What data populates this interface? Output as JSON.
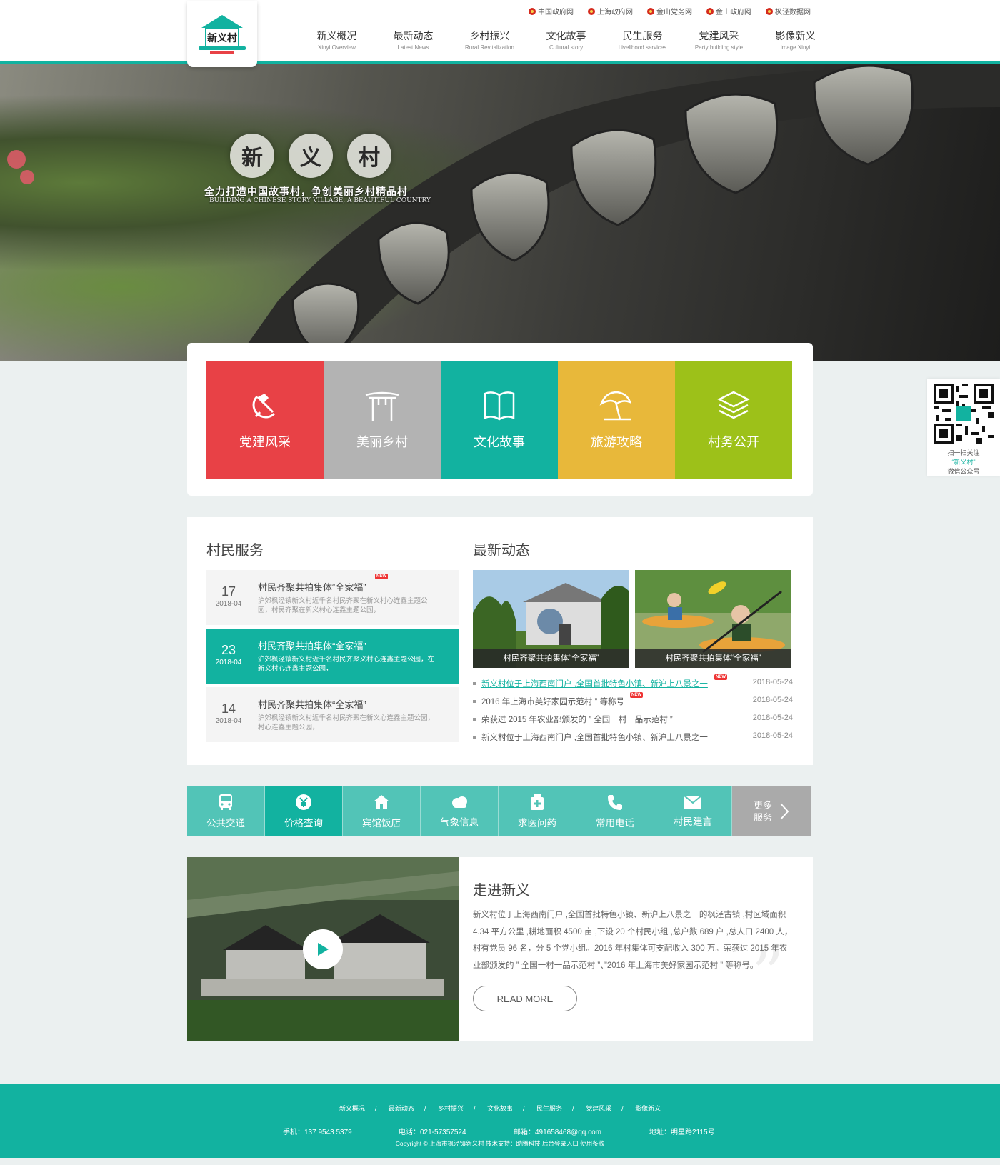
{
  "header": {
    "logo_text": "新义村",
    "top_links": [
      "中国政府网",
      "上海政府网",
      "金山党务网",
      "金山政府网",
      "枫泾数据网"
    ],
    "nav": [
      {
        "cn": "新义概况",
        "en": "Xinyi Overview"
      },
      {
        "cn": "最新动态",
        "en": "Latest News"
      },
      {
        "cn": "乡村振兴",
        "en": "Rural Revitalization"
      },
      {
        "cn": "文化故事",
        "en": "Cultural story"
      },
      {
        "cn": "民生服务",
        "en": "Livelihood services"
      },
      {
        "cn": "党建风采",
        "en": "Party building style"
      },
      {
        "cn": "影像新义",
        "en": "image Xinyi"
      }
    ]
  },
  "banner": {
    "chars": [
      "新",
      "义",
      "村"
    ],
    "slogan": "全力打造中国故事村，争创美丽乡村精品村",
    "slogan_en": "BUILDING A CHINESE STORY VILLAGE, A BEAUTIFUL COUNTRY"
  },
  "tiles": [
    {
      "label": "党建风采",
      "icon": "hammer-sickle-icon",
      "color": "#e84146"
    },
    {
      "label": "美丽乡村",
      "icon": "archway-icon",
      "color": "#b3b3b3"
    },
    {
      "label": "文化故事",
      "icon": "book-icon",
      "color": "#12b2a0"
    },
    {
      "label": "旅游攻略",
      "icon": "beach-umbrella-icon",
      "color": "#e8b83a"
    },
    {
      "label": "村务公开",
      "icon": "layers-icon",
      "color": "#9dc119"
    }
  ],
  "qr": {
    "line1": "扫一扫关注",
    "line2": "“新义村”",
    "line3": "微信公众号"
  },
  "services": {
    "title": "村民服务",
    "items": [
      {
        "day": "17",
        "month": "2018-04",
        "title": "村民齐聚共拍集体“全家福”",
        "desc": "沪郊枫泾镇新义村近千名村民齐聚在新义村心连鑫主题公园，村民齐聚在新义村心连鑫主题公园，",
        "badge": "NEW"
      },
      {
        "day": "23",
        "month": "2018-04",
        "title": "村民齐聚共拍集体“全家福”",
        "desc": "沪郊枫泾镇新义村近千名村民齐聚义村心连鑫主题公园，在新义村心连鑫主题公园，"
      },
      {
        "day": "14",
        "month": "2018-04",
        "title": "村民齐聚共拍集体“全家福”",
        "desc": "沪郊枫泾镇新义村近千名村民齐聚在新义心连鑫主题公园，村心连鑫主题公园，"
      }
    ]
  },
  "news": {
    "title": "最新动态",
    "images": [
      {
        "caption": "村民齐聚共拍集体“全家福”"
      },
      {
        "caption": "村民齐聚共拍集体“全家福”"
      }
    ],
    "list": [
      {
        "text": "新义村位于上海西南门户 ,全国首批特色小镇、新沪上八景之一",
        "date": "2018-05-24",
        "badge": "NEW"
      },
      {
        "text": "2016 年上海市美好家园示范村 ” 等称号",
        "date": "2018-05-24",
        "badge": "NEW"
      },
      {
        "text": "荣获过 2015 年农业部颁发的 ” 全国一村一品示范村 ”",
        "date": "2018-05-24"
      },
      {
        "text": "新义村位于上海西南门户 ,全国首批特色小镇、新沪上八景之一",
        "date": "2018-05-24"
      }
    ]
  },
  "service_bar": {
    "items": [
      {
        "label": "公共交通",
        "icon": "bus-icon"
      },
      {
        "label": "价格查询",
        "icon": "yen-icon"
      },
      {
        "label": "宾馆饭店",
        "icon": "hotel-icon"
      },
      {
        "label": "气象信息",
        "icon": "weather-icon"
      },
      {
        "label": "求医问药",
        "icon": "medicine-icon"
      },
      {
        "label": "常用电话",
        "icon": "phone-icon"
      },
      {
        "label": "村民建言",
        "icon": "mail-icon"
      }
    ],
    "more_line1": "更多",
    "more_line2": "服务"
  },
  "about": {
    "title": "走进新义",
    "text": "新义村位于上海西南门户 ,全国首批特色小镇、新沪上八景之一的枫泾古镇 ,村区域面积 4.34 平方公里 ,耕地面积 4500 亩 ,下设 20 个村民小组 ,总户数 689 户 ,总人口 2400 人，村有党员 96 名，分 5 个党小组。2016 年村集体可支配收入 300 万。荣获过 2015 年农业部颁发的 ” 全国一村一品示范村 ”、”2016 年上海市美好家园示范村 ” 等称号。",
    "read_more": "READ MORE"
  },
  "footer": {
    "nav": [
      "新义概况",
      "最新动态",
      "乡村振兴",
      "文化故事",
      "民生服务",
      "党建风采",
      "影像新义"
    ],
    "separator": "/",
    "mobile": "手机：137 9543 5379",
    "phone": "电话：021-57357524",
    "email": "邮箱：491658468@qq.com",
    "address": "地址：明星路2115号",
    "copyright": "Copyright © 上海市枫泾镇新义村  技术支持：助腾科技  后台登录入口  使用条款"
  },
  "colors": {
    "accent": "#12b2a0",
    "red": "#e84146",
    "grey": "#b3b3b3",
    "yellow": "#e8b83a",
    "green": "#9dc119"
  }
}
